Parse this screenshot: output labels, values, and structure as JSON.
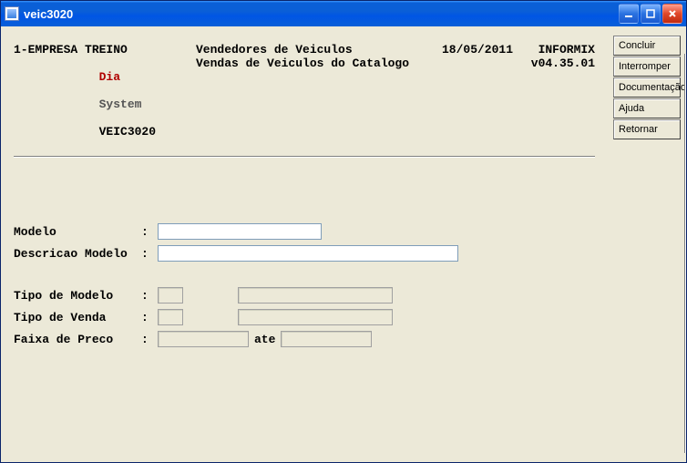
{
  "window": {
    "title": "veic3020"
  },
  "header": {
    "company": "1-EMPRESA TREINO",
    "title1": "Vendedores de Veiculos",
    "date": "18/05/2011",
    "db": "INFORMIX",
    "dia": "Dia",
    "system": "System",
    "program": "VEIC3020",
    "title2": "Vendas de Veiculos do Catalogo",
    "version": "v04.35.01"
  },
  "form": {
    "modelo_label": "Modelo",
    "descricao_label": "Descricao Modelo",
    "tipo_modelo_label": "Tipo de Modelo",
    "tipo_venda_label": "Tipo de Venda",
    "faixa_preco_label": "Faixa de Preco",
    "ate_label": "ate",
    "modelo": "",
    "descricao": "",
    "tipo_modelo_code": "",
    "tipo_modelo_desc": "",
    "tipo_venda_code": "",
    "tipo_venda_desc": "",
    "preco_de": "",
    "preco_ate": ""
  },
  "sidebar": {
    "buttons": [
      {
        "label": "Concluir"
      },
      {
        "label": "Interromper"
      },
      {
        "label": "Documentação"
      },
      {
        "label": "Ajuda"
      },
      {
        "label": "Retornar"
      }
    ]
  }
}
